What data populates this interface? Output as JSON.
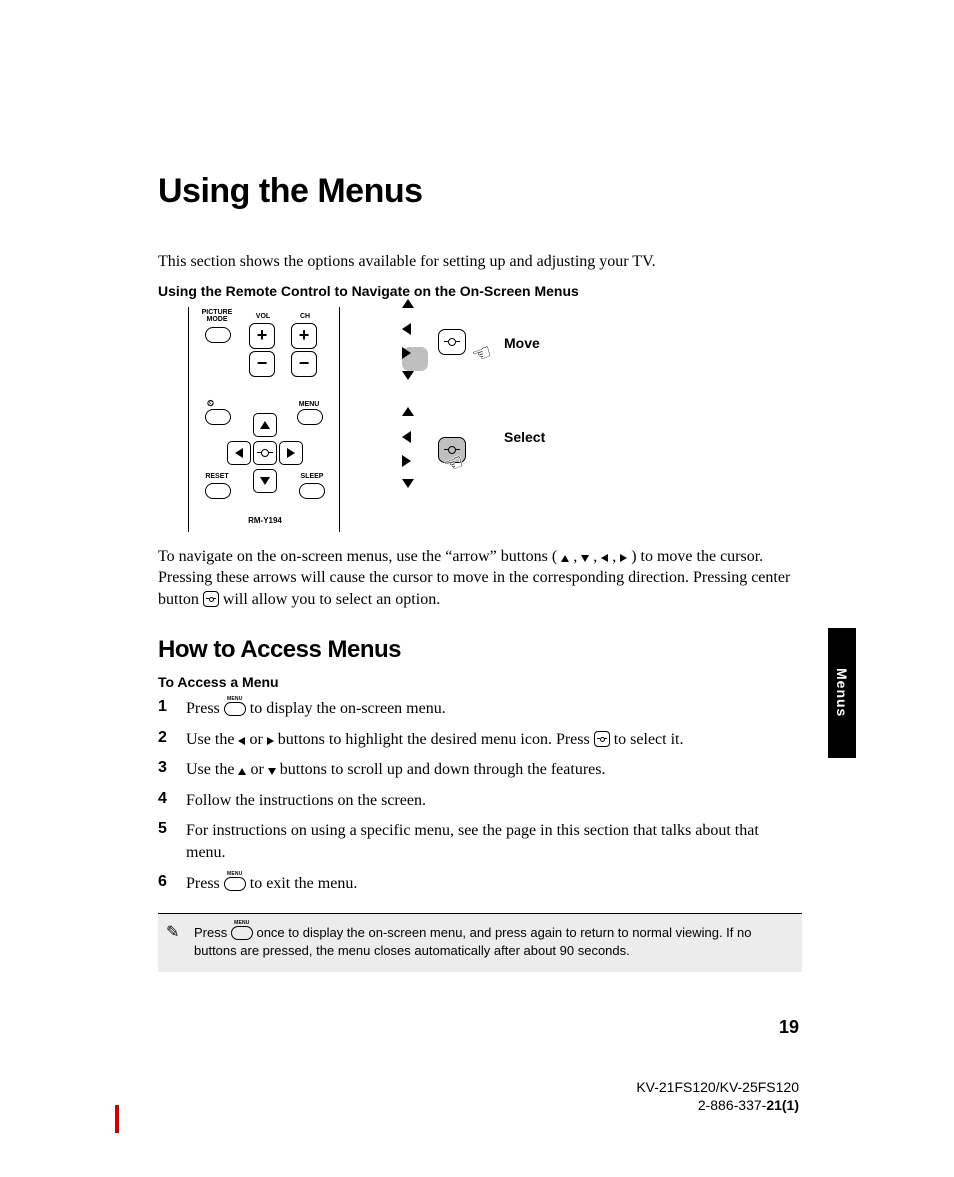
{
  "title": "Using the Menus",
  "intro": "This section shows the options available for setting up and adjusting your TV.",
  "remote_heading": "Using the Remote Control to Navigate on the On-Screen Menus",
  "figure": {
    "labels": {
      "picture_mode": "PICTURE MODE",
      "vol": "VOL",
      "ch": "CH",
      "menu": "MENU",
      "reset": "RESET",
      "sleep": "SLEEP",
      "model": "RM-Y194",
      "move": "Move",
      "select": "Select"
    }
  },
  "nav_para_1": "To navigate on the on-screen menus, use the “arrow” buttons (",
  "nav_para_2": ") to move the cursor. Pressing these arrows will cause the cursor to move in the corresponding direction. Pressing center button ",
  "nav_para_3": " will allow you to select an option.",
  "arrow_sep": " , ",
  "access_heading": "How to Access Menus",
  "access_sub": "To Access a Menu",
  "steps": [
    {
      "n": "1",
      "pre": "Press ",
      "post": " to display the on-screen menu.",
      "insert": "menu"
    },
    {
      "n": "2",
      "pre": "Use the ",
      "mid": " or ",
      "post_a": " buttons to highlight the desired menu icon. Press ",
      "post_b": " to select it.",
      "a1": "left",
      "a2": "right",
      "insert2": "center"
    },
    {
      "n": "3",
      "pre": "Use the ",
      "mid": " or ",
      "post": " buttons to scroll up and down through the features.",
      "a1": "up",
      "a2": "down"
    },
    {
      "n": "4",
      "txt": "Follow the instructions on the screen."
    },
    {
      "n": "5",
      "txt": "For instructions on using a specific menu, see the page in this section that talks about that menu."
    },
    {
      "n": "6",
      "pre": "Press ",
      "post": " to exit the menu.",
      "insert": "menu"
    }
  ],
  "note_pre": "Press ",
  "note_post": " once to display the on-screen menu, and press again to return to normal viewing. If no buttons are pressed, the menu closes automatically after about 90 seconds.",
  "side_tab": "Menus",
  "page_number": "19",
  "footer_model": "KV-21FS120/KV-25FS120",
  "footer_doc_a": "2-886-337-",
  "footer_doc_b": "21(1)"
}
